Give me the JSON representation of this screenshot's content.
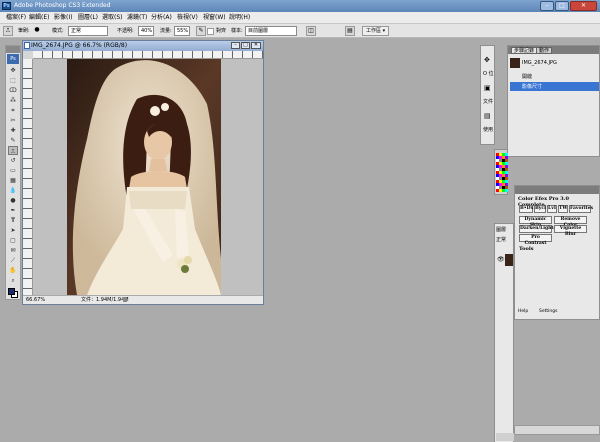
{
  "titlebar": {
    "title": "Adobe Photoshop CS3 Extended",
    "min": "–",
    "max": "□",
    "close": "✕"
  },
  "menu": [
    "檔案(F)",
    "編輯(E)",
    "影像(I)",
    "圖層(L)",
    "選取(S)",
    "濾鏡(T)",
    "分析(A)",
    "檢視(V)",
    "視窗(W)",
    "說明(H)"
  ],
  "options": {
    "brush_label": "筆刷:",
    "mode_label": "模式:",
    "mode_value": "正常",
    "opacity_label": "不透明:",
    "opacity_value": "40%",
    "flow_label": "流量:",
    "flow_value": "55%",
    "align_label": "對齊",
    "sample_label": "樣本:",
    "sample_value": "目前圖層",
    "workspace": "工作區 ▾"
  },
  "document": {
    "title": "IMG_2674.JPG @ 66.7% (RGB/8)",
    "zoom": "66.67%",
    "doc_info": "文件：1.94M/1.94M"
  },
  "panels": {
    "history_tab": "步驟記錄",
    "actions_tab": "動作",
    "history_file": "IMG_2674.JPG",
    "history_items": [
      "開啟",
      "影像尺寸"
    ],
    "partial_labels": [
      "O 位",
      "文件",
      "使用"
    ],
    "layers_labels": [
      "圖層",
      "正常"
    ],
    "plugin_title": "Color Efex Pro 3.0 Complete",
    "plugin_buttons": [
      "B•Dx",
      "Bycl",
      "LvI",
      "TW",
      "Favorites"
    ],
    "plugin_filters": [
      "Dynamic Skin",
      "Remove Color",
      "Darken/Lighten",
      "Vignette Blur",
      "Pro Contrast"
    ],
    "plugin_tools": "Tools",
    "plugin_footer": [
      "Help",
      "Settings"
    ]
  },
  "icons": {
    "photoshop": "ps-logo-icon",
    "move": "move-icon",
    "marquee": "marquee-icon",
    "lasso": "lasso-icon",
    "brush": "brush-icon",
    "stamp": "clone-stamp-icon",
    "eraser": "eraser-icon",
    "text": "text-icon",
    "hand": "hand-icon",
    "zoom": "zoom-icon",
    "eye": "eye-icon"
  },
  "colors": {
    "foreground": "#1a2b6b",
    "background": "#ffffff",
    "history_highlight": "#3a75d4"
  }
}
